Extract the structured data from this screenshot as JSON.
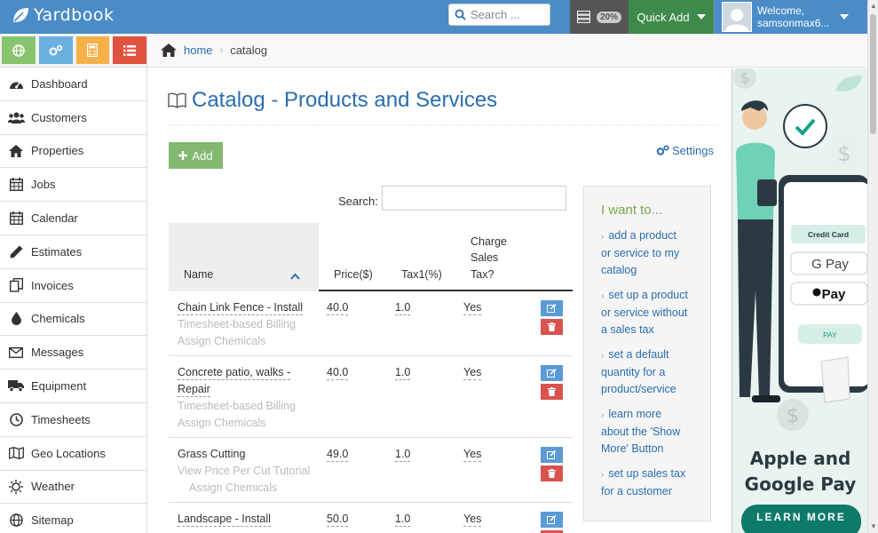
{
  "app": {
    "name": "Yardbook"
  },
  "topbar": {
    "search_placeholder": "Search ...",
    "progress_badge": "20%",
    "quick_add_label": "Quick Add",
    "welcome_label": "Welcome,",
    "username": "samsonmax6..."
  },
  "breadcrumb": {
    "home": "home",
    "current": "catalog"
  },
  "sidebar": {
    "items": [
      {
        "label": "Dashboard",
        "icon": "dashboard-icon"
      },
      {
        "label": "Customers",
        "icon": "users-icon"
      },
      {
        "label": "Properties",
        "icon": "home-icon"
      },
      {
        "label": "Jobs",
        "icon": "calendar-grid-icon"
      },
      {
        "label": "Calendar",
        "icon": "calendar-icon"
      },
      {
        "label": "Estimates",
        "icon": "pencil-icon"
      },
      {
        "label": "Invoices",
        "icon": "copy-icon"
      },
      {
        "label": "Chemicals",
        "icon": "droplet-icon"
      },
      {
        "label": "Messages",
        "icon": "envelope-icon"
      },
      {
        "label": "Equipment",
        "icon": "truck-icon"
      },
      {
        "label": "Timesheets",
        "icon": "clock-icon"
      },
      {
        "label": "Geo Locations",
        "icon": "map-icon"
      },
      {
        "label": "Weather",
        "icon": "sun-icon"
      },
      {
        "label": "Sitemap",
        "icon": "globe-icon"
      }
    ]
  },
  "page": {
    "title": "Catalog - Products and Services",
    "add_label": "Add",
    "settings_label": "Settings",
    "search_label": "Search:"
  },
  "table": {
    "headers": {
      "name": "Name",
      "price": "Price($)",
      "tax1": "Tax1(%)",
      "charge_l1": "Charge",
      "charge_l2": "Sales",
      "charge_l3": "Tax?"
    },
    "rows": [
      {
        "name_l1": "Chain Link Fence - Install",
        "name_l2": "",
        "price": "40.0",
        "tax": "1.0",
        "charge": "Yes",
        "sub1": "Timesheet-based Billing",
        "sub2": "Assign Chemicals"
      },
      {
        "name_l1": "Concrete patio, walks -",
        "name_l2": "Repair",
        "price": "40.0",
        "tax": "1.0",
        "charge": "Yes",
        "sub1": "Timesheet-based Billing",
        "sub2": "Assign Chemicals"
      },
      {
        "name_l1": "Grass Cutting",
        "name_l2": "",
        "price": "49.0",
        "tax": "1.0",
        "charge": "Yes",
        "sub1": "View Price Per Cut Tutorial",
        "sub2": "Assign Chemicals"
      },
      {
        "name_l1": "Landscape - Install",
        "name_l2": "",
        "price": "50.0",
        "tax": "1.0",
        "charge": "Yes",
        "sub1": "",
        "sub2": ""
      }
    ]
  },
  "want_panel": {
    "title": "I want to...",
    "links": [
      {
        "l1": "add a product",
        "l2": "or service to my",
        "l3": "catalog"
      },
      {
        "l1": "set up a product",
        "l2": "or service without",
        "l3": "a sales tax"
      },
      {
        "l1": "set a default",
        "l2": "quantity for a",
        "l3": "product/service"
      },
      {
        "l1": "learn more",
        "l2": "about the 'Show",
        "l3": "More' Button"
      },
      {
        "l1": "set up sales tax",
        "l2": "for a customer",
        "l3": ""
      }
    ]
  },
  "ad": {
    "card_label": "Credit Card",
    "gpay": "G Pay",
    "apay": "Pay",
    "pay": "PAY",
    "title_l1": "Apple and",
    "title_l2": "Google Pay",
    "button": "LEARN MORE"
  },
  "colors": {
    "brand_blue": "#4a8cc7",
    "link_blue": "#2a6db0",
    "quick_add_green": "#3d8a4a",
    "add_green": "#82b96f",
    "edit_blue": "#5b9bd5",
    "delete_red": "#d9534f",
    "panel_title_green": "#7aa84a"
  }
}
